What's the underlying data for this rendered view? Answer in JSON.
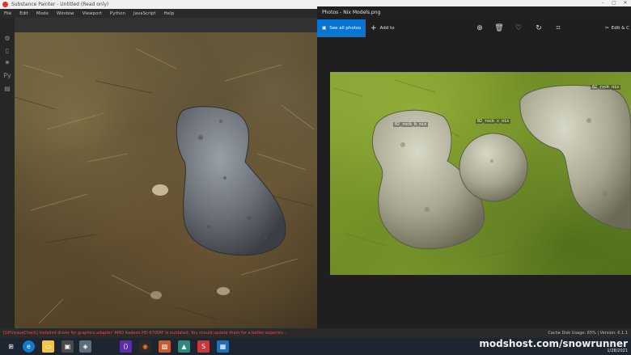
{
  "substance_painter": {
    "title": "Substance Painter - Untitled (Read only)",
    "menu": [
      "File",
      "Edit",
      "Mode",
      "Window",
      "Viewport",
      "Python",
      "JavaScript",
      "Help"
    ],
    "console_message": "[GPUIssueCheck] Installed driver for graphics adapter 'AMD Radeon HD 6700M' is outdated. You should update them for a better experien..."
  },
  "photos": {
    "title": "Photos - Nix Models.png",
    "see_all_label": "See all photos",
    "add_to_label": "Add to",
    "edit_label": "Edit & C",
    "rock_labels": [
      "02_rock_b_nix",
      "02_rock_c_nix",
      "02_rock_nix"
    ]
  },
  "status": {
    "cache_text": "Cache Disk Usage:",
    "version_text": "65% | Version: 6.1.1"
  },
  "taskbar": {
    "date": "1/28/2021",
    "icons": [
      "windows-logo",
      "edge",
      "file-explorer",
      "folder",
      "substance-painter",
      "vscode",
      "blender",
      "photos",
      "3d-app",
      "substance",
      "photos-2"
    ]
  },
  "watermark": "modshost.com/snowrunner",
  "colors": {
    "accent_blue": "#0a74d3",
    "console_warning": "#d9534f"
  }
}
